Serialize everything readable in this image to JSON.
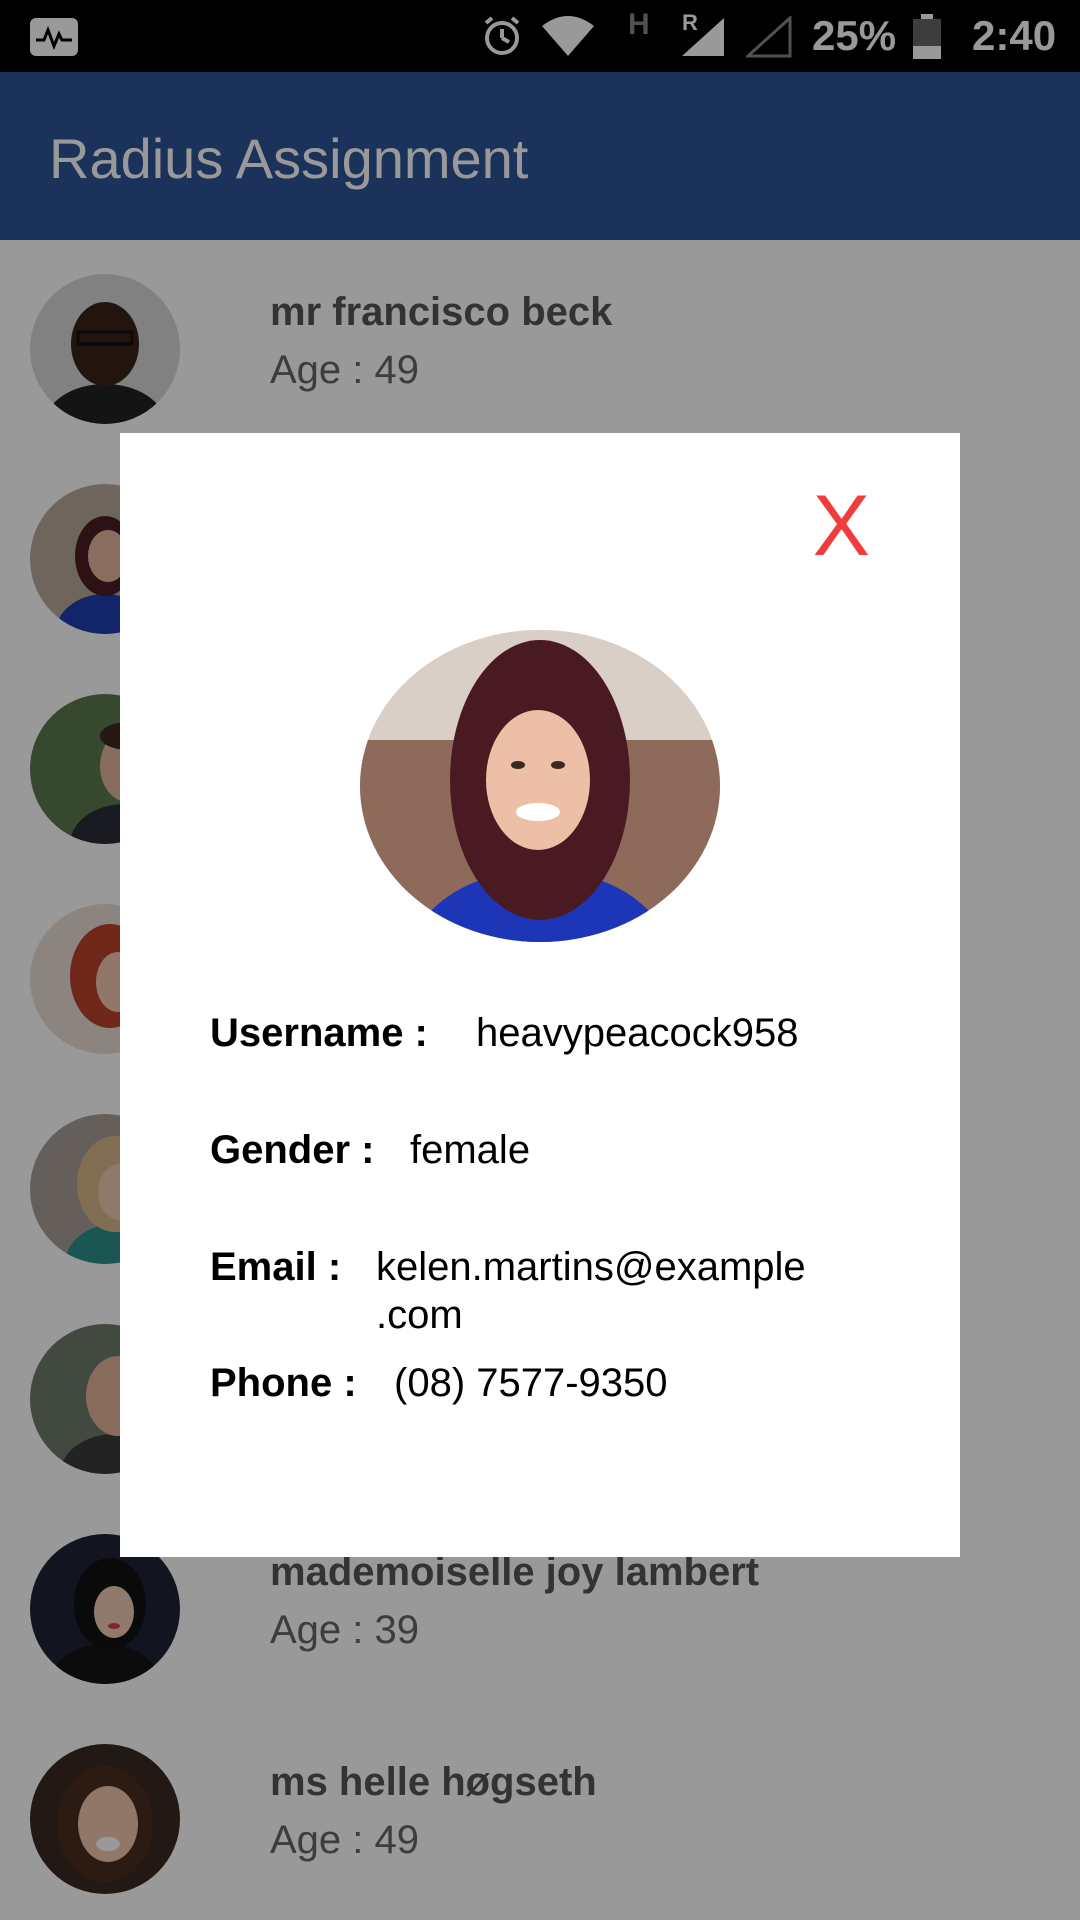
{
  "status_bar": {
    "battery": "25%",
    "time": "2:40",
    "network_h": "H",
    "network_r": "R"
  },
  "app_bar": {
    "title": "Radius Assignment"
  },
  "list": {
    "items": [
      {
        "name": "mr francisco beck",
        "age": "Age : 49"
      },
      {
        "name": "",
        "age": ""
      },
      {
        "name": "",
        "age": ""
      },
      {
        "name": "",
        "age": ""
      },
      {
        "name": "",
        "age": ""
      },
      {
        "name": "",
        "age": ""
      },
      {
        "name": "mademoiselle joy lambert",
        "age": "Age : 39"
      },
      {
        "name": "ms helle høgseth",
        "age": "Age : 49"
      }
    ]
  },
  "dialog": {
    "close_label": "X",
    "username_label": "Username :",
    "username_value": "heavypeacock958",
    "gender_label": "Gender :",
    "gender_value": "female",
    "email_label": "Email :",
    "email_value_line1": "kelen.martins@example",
    "email_value_line2": ".com",
    "phone_label": "Phone :",
    "phone_value": "(08) 7577-9350"
  },
  "colors": {
    "app_bar": "#2E5597",
    "close": "#F03C3C"
  }
}
